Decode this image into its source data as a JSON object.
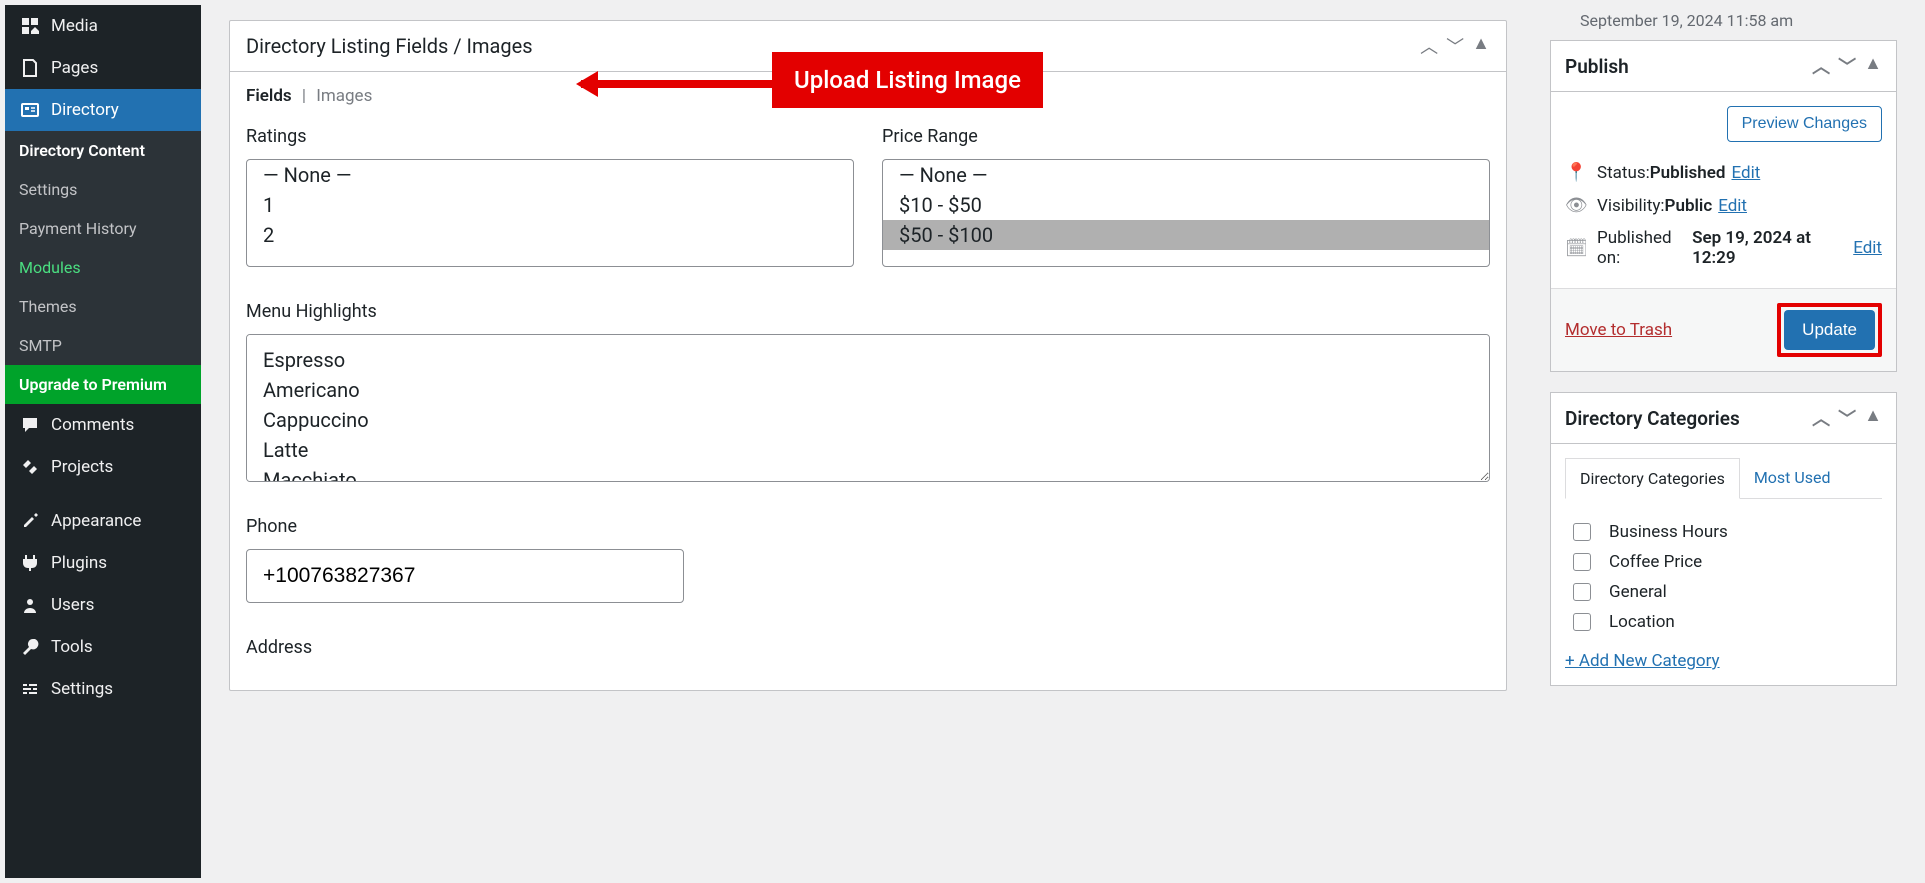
{
  "sidebar": {
    "media": "Media",
    "pages": "Pages",
    "directory": "Directory",
    "sub": {
      "content": "Directory Content",
      "settings": "Settings",
      "payment": "Payment History",
      "modules": "Modules",
      "themes": "Themes",
      "smtp": "SMTP",
      "upgrade": "Upgrade to Premium"
    },
    "comments": "Comments",
    "projects": "Projects",
    "appearance": "Appearance",
    "plugins": "Plugins",
    "users": "Users",
    "tools": "Tools",
    "settings": "Settings"
  },
  "panel": {
    "title": "Directory Listing Fields / Images",
    "tabs": {
      "fields": "Fields",
      "images": "Images"
    },
    "ratings_label": "Ratings",
    "price_label": "Price Range",
    "ratings": {
      "none": "— None —",
      "one": "1",
      "two": "2"
    },
    "price": {
      "none": "— None —",
      "p1": "$10 - $50",
      "p2": "$50 - $100"
    },
    "menu_label": "Menu Highlights",
    "menu": {
      "m1": "Espresso",
      "m2": "Americano",
      "m3": "Cappuccino",
      "m4": "Latte",
      "m5": "Macchiato"
    },
    "phone_label": "Phone",
    "phone_value": "+100763827367",
    "address_label": "Address"
  },
  "topdate": "September 19, 2024 11:58 am",
  "publish": {
    "title": "Publish",
    "preview": "Preview Changes",
    "status_label": "Status: ",
    "status_value": "Published",
    "visibility_label": "Visibility: ",
    "visibility_value": "Public",
    "published_label": "Published on: ",
    "published_value": "Sep 19, 2024 at 12:29",
    "edit": "Edit",
    "trash": "Move to Trash",
    "update": "Update"
  },
  "categories": {
    "title": "Directory Categories",
    "tab1": "Directory Categories",
    "tab2": "Most Used",
    "items": {
      "c1": "Business Hours",
      "c2": "Coffee Price",
      "c3": "General",
      "c4": "Location"
    },
    "add": "+ Add New Category"
  },
  "callout": "Upload Listing Image"
}
